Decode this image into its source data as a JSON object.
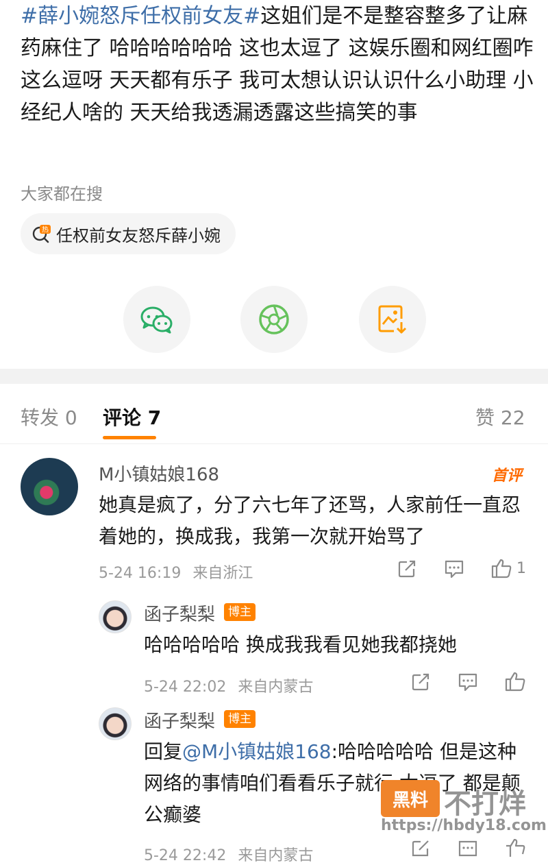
{
  "post": {
    "topic": "#薛小婉怒斥任权前女友#",
    "text": "这姐们是不是整容整多了让麻药麻住了 哈哈哈哈哈哈 这也太逗了 这娱乐圈和网红圈咋这么逗呀 天天都有乐子 我可太想认识认识什么小助理 小经纪人啥的 天天给我透漏透露这些搞笑的事"
  },
  "hot_search": {
    "label": "大家都在搜",
    "badge": "热",
    "query": "任权前女友怒斥薛小婉"
  },
  "share": {
    "icons": [
      "wechat-icon",
      "moments-icon",
      "save-image-icon"
    ],
    "colors": {
      "wechat": "#2aae67",
      "moments": "#66c25c",
      "save": "#ff9c00"
    }
  },
  "tabs": {
    "repost": "转发 0",
    "comments": "评论 7",
    "likes": "赞 22"
  },
  "comments": [
    {
      "user": "M小镇姑娘168",
      "badge": "首评",
      "text": "她真是疯了，分了六七年了还骂，人家前任一直忍着她的，换成我，我第一次就开始骂了",
      "time": "5-24 16:19",
      "location": "来自浙江",
      "like_count": "1",
      "replies": [
        {
          "user": "函子梨梨",
          "badge": "博主",
          "text": "哈哈哈哈哈 换成我我看见她我都挠她",
          "time": "5-24 22:02",
          "location": "来自内蒙古"
        },
        {
          "user": "函子梨梨",
          "badge": "博主",
          "reply_prefix": "回复",
          "mention": "@M小镇姑娘168",
          "text": ":哈哈哈哈哈  但是这种网络的事情咱们看看乐子就行 太逗了 都是颠公癫婆",
          "time": "5-24 22:42",
          "location": "来自内蒙古"
        }
      ]
    }
  ],
  "watermark": {
    "box": "黑料",
    "text": "不打烊",
    "url": "https://hbdy18.com"
  },
  "accent_color": "#ff8200"
}
